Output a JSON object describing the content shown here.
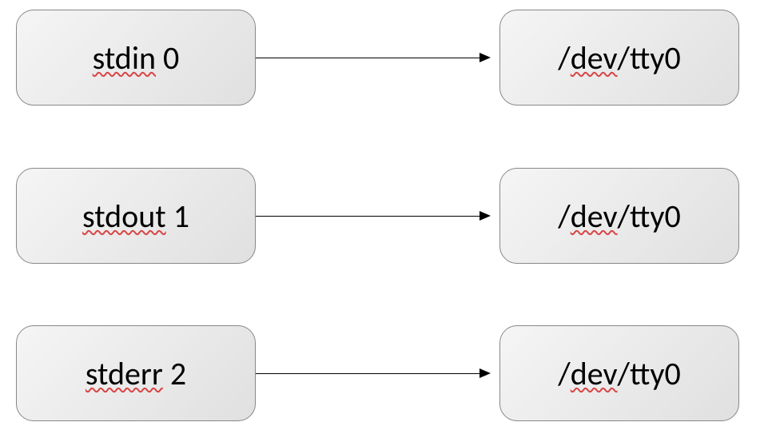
{
  "rows": [
    {
      "left_pre": "stdin",
      "left_post": " 0",
      "right_pre": "/",
      "right_mid": "dev",
      "right_post": "/tty0"
    },
    {
      "left_pre": "stdout",
      "left_post": " 1",
      "right_pre": "/",
      "right_mid": "dev",
      "right_post": "/tty0"
    },
    {
      "left_pre": "stderr",
      "left_post": " 2",
      "right_pre": "/",
      "right_mid": "dev",
      "right_post": "/tty0"
    }
  ]
}
